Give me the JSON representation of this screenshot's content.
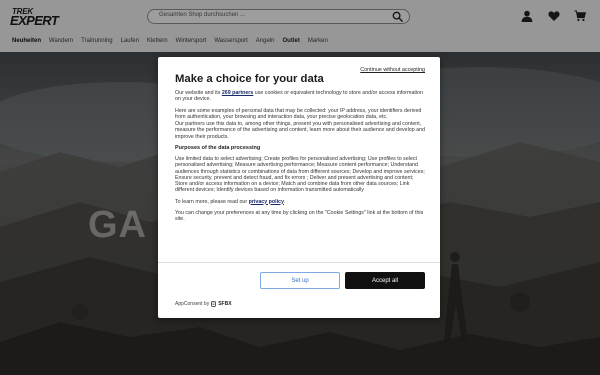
{
  "header": {
    "logo": {
      "line1": "TREK",
      "line2": "EXPERT"
    },
    "search": {
      "placeholder": "Gesamten Shop durchsuchen ..."
    },
    "icons": [
      "search-icon",
      "user-icon",
      "heart-icon",
      "cart-icon"
    ]
  },
  "nav": {
    "items": [
      "Neuheiten",
      "Wandern",
      "Trailrunning",
      "Laufen",
      "Klettern",
      "Wintersport",
      "Wassersport",
      "Angeln",
      "Outlet",
      "Marken"
    ]
  },
  "hero": {
    "title": "GA"
  },
  "consent": {
    "continue_label": "Continue without accepting",
    "title": "Make a choice for your data",
    "p1_pre": "Our website and its ",
    "p1_link": "269 partners",
    "p1_post": " use cookies or equivalent technology to store and/or access information on your device.",
    "p2": "Here are some examples of personal data that may be collected: your IP address, your identifiers derived from authentication, your browsing and interaction data, your precise geolocation data, etc.",
    "p3": "Our partners use this data to, among other things, present you with personalised advertising and content, measure the performance of the advertising and content, learn more about their audience and develop and improve their products.",
    "purposes_heading": "Purposes of the data processing",
    "purposes": "Use limited data to select advertising; Create profiles for personalised advertising; Use profiles to select personalised advertising; Measure advertising performance; Measure content performance; Understand audiences through statistics or combinations of data from different sources; Develop and improve services; Ensure security, prevent and detect fraud, and fix errors ; Deliver and present advertising and content; Store and/or access information on a device; Match and combine data from other data sources; Link different devices; Identify devices based on information transmitted automatically",
    "learn_pre": "To learn more, please read our ",
    "learn_link": "privacy policy",
    "learn_post": ".",
    "change": "You can change your preferences at any time by clicking on the \"Cookie Settings\" link at the bottom of this site.",
    "setup_label": "Set up",
    "accept_label": "Accept all",
    "footer_pre": "AppConsent by",
    "footer_brand": "SFBX"
  },
  "colors": {
    "accept_bg": "#111111",
    "setup_border": "#7da9e6",
    "link": "#1a2b6b"
  }
}
